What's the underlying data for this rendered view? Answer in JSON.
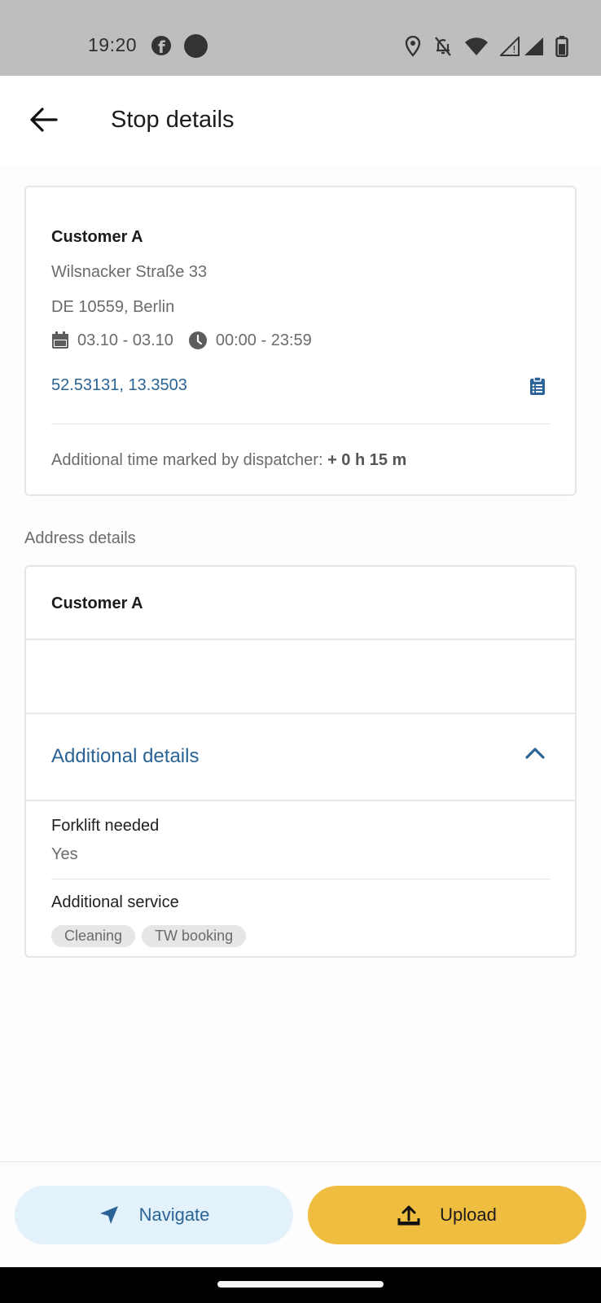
{
  "status_bar": {
    "time": "19:20",
    "icons": [
      "facebook-icon",
      "dot-icon",
      "location-icon",
      "bell-off-icon",
      "wifi-icon",
      "signal-icon",
      "battery-icon"
    ]
  },
  "app_bar": {
    "title": "Stop details",
    "back_icon": "arrow-left-icon"
  },
  "stop": {
    "customer": "Customer A",
    "street": "Wilsnacker Straße 33",
    "city": "DE 10559, Berlin",
    "date_range": "03.10 - 03.10",
    "time_range": "00:00 - 23:59",
    "coordinates": "52.53131, 13.3503",
    "additional_time_label": "Additional time marked by dispatcher:",
    "additional_time_value": "+ 0 h 15 m"
  },
  "address_section": {
    "label": "Address details",
    "customer": "Customer A",
    "additional_details_title": "Additional details",
    "forklift_label": "Forklift needed",
    "forklift_value": "Yes",
    "service_label": "Additional service",
    "services": [
      "Cleaning",
      "TW booking"
    ]
  },
  "actions": {
    "navigate_label": "Navigate",
    "upload_label": "Upload"
  },
  "colors": {
    "accent": "#2a6496",
    "upload_button": "#efbd3f",
    "navigate_button": "#e3f1fb"
  }
}
